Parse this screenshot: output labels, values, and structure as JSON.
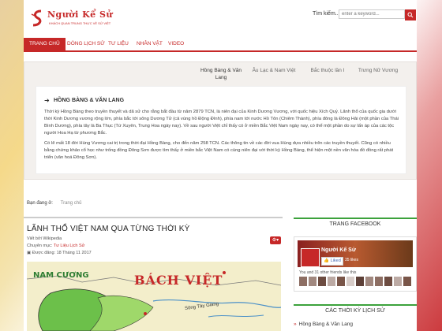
{
  "logo": {
    "title": "Người Kể Sử",
    "subtitle": "KHÁCH QUAN TRUNG THỰC VỀ SỬ VIỆT"
  },
  "search": {
    "label": "Tìm kiếm...",
    "placeholder": "enter a keyword...",
    "button_icon": "search-icon"
  },
  "nav": {
    "items": [
      "Trang chủ",
      "Dòng lịch sử",
      "Tư liệu",
      "Nhân vật",
      "Video"
    ],
    "active": "Trang chủ"
  },
  "hero": {
    "tabs": [
      "Hồng Bàng & Văn Lang",
      "Âu Lạc & Nam Việt",
      "Bắc thuộc lần I",
      "Trưng Nữ Vương"
    ],
    "heading": "HỒNG BÀNG & VĂN LANG",
    "p1": "Thời kỳ Hồng Bàng theo truyền thuyết và dã sử cho rằng bắt đầu từ năm 2879 TCN, là niên đại của Kinh Dương Vương, với quốc hiệu Xích Quỷ. Lãnh thổ của quốc gia dưới thời Kinh Dương vương rộng lớn, phía bắc tới sông Dương Tử (cả vùng hồ Động Đình), phía nam tới nước Hồ Tôn (Chiêm Thành), phía đông là Đông Hải (một phần của Thái Bình Dương), phía tây là Ba Thục (Tứ Xuyên, Trung Hoa ngày nay). Về sau người Việt chỉ thấy có ở miền Bắc Việt Nam ngày nay, có thể một phần do sự lấn áp của các tộc người Hoa Hạ từ phương Bắc.",
    "p2": "Có lẽ mất 18 đời Hùng Vương cai trị trong thời đại Hồng Bàng, cho đến năm 258 TCN. Các thông tin về các đời vua Hùng dựa nhiều trên các truyền thuyết. Cũng có nhiều bằng chứng khảo cổ học như trống đồng Đông Sơn được tìm thấy ở miền bắc Việt Nam có cùng niên đại với thời kỳ Hồng Bàng, thể hiện một nền văn hóa đồ đồng rất phát triển (văn hoá Đông Sơn)."
  },
  "breadcrumb": {
    "label": "Bạn đang ở:",
    "link": "Trang chủ"
  },
  "article": {
    "title": "LÃNH THỔ VIỆT NAM QUA TỪNG THỜI KỲ",
    "author": "Viết bởi Wikipedia",
    "category_label": "Chuyên mục:",
    "category": "Tư Liệu Lịch Sử",
    "date": "Được đăng: 18 Tháng 11 2017",
    "map_labels": {
      "a": "NAM CƯƠNG",
      "b": "BÁCH VIỆT",
      "c": "Sông Tây Giang"
    }
  },
  "sidebar": {
    "facebook_heading": "TRANG FACEBOOK",
    "fb_page": "Người Kể Sử",
    "fb_like": "Liked",
    "fb_likes": "35 likes",
    "fb_friends": "You and 31 other friends like this",
    "periods_heading": "CÁC THỜI KỲ LỊCH SỬ",
    "periods": [
      "Hồng Bàng & Văn Lang"
    ]
  },
  "colors": {
    "brand": "#c62828",
    "accent_green": "#3ca23c"
  }
}
